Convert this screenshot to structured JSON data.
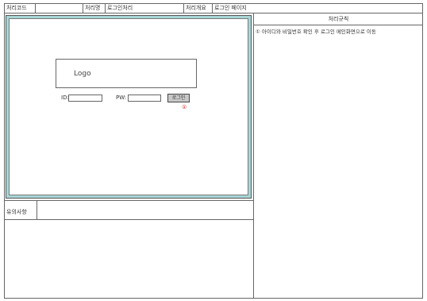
{
  "header": {
    "code_label": "처리코드",
    "code_value": "",
    "name_label": "처리명",
    "name_value": "로그인처리",
    "overview_label": "처리개요",
    "overview_value": "로그인 페이지"
  },
  "screen": {
    "logo_text": "Logo",
    "id_label": "ID:",
    "id_value": "",
    "pw_label": "PW:",
    "pw_value": "",
    "login_button": "로그인",
    "marker": "①"
  },
  "notes": {
    "label": "유의사항",
    "value": ""
  },
  "rules": {
    "title": "처리규칙",
    "items": [
      "① 아이디와 비밀번호 확인 후 로그인 메인화면으로 이동"
    ]
  }
}
